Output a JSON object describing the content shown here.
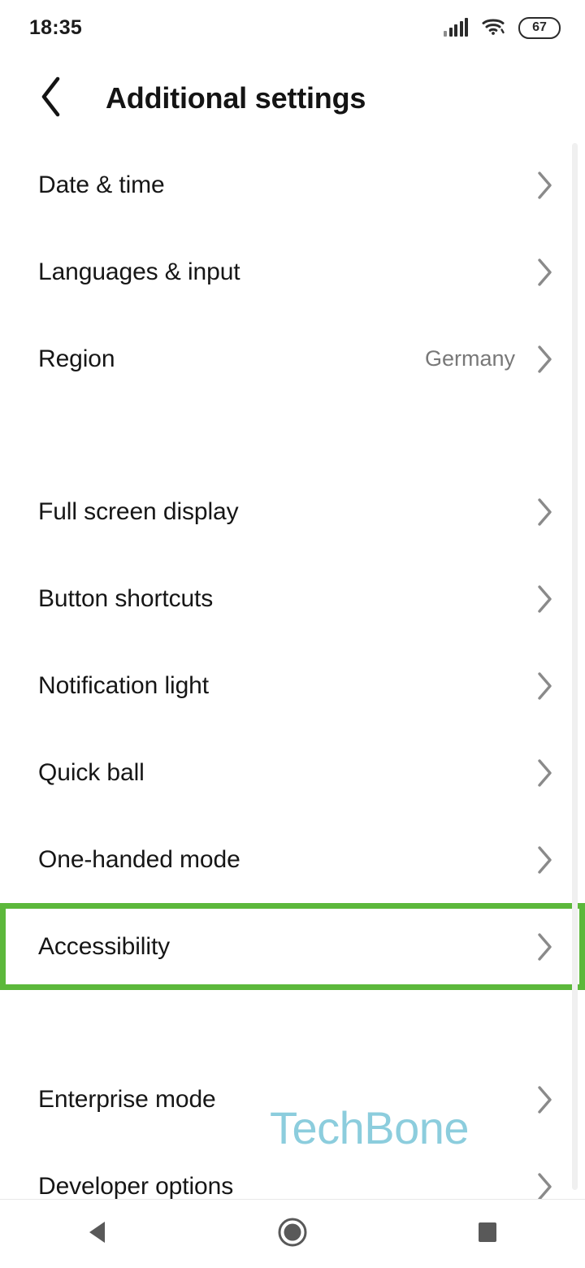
{
  "status_bar": {
    "time": "18:35",
    "signal_icon": "signal-bars-icon",
    "wifi_icon": "wifi-icon",
    "battery_icon": "battery-icon",
    "battery_level": "67"
  },
  "app_bar": {
    "back_icon": "back-chevron-icon",
    "title": "Additional settings"
  },
  "groups": [
    {
      "rows": [
        {
          "label": "Date & time",
          "value": "",
          "chevron": "chevron-right-icon",
          "highlighted": false
        },
        {
          "label": "Languages & input",
          "value": "",
          "chevron": "chevron-right-icon",
          "highlighted": false
        },
        {
          "label": "Region",
          "value": "Germany",
          "chevron": "chevron-right-icon",
          "highlighted": false
        }
      ]
    },
    {
      "rows": [
        {
          "label": "Full screen display",
          "value": "",
          "chevron": "chevron-right-icon",
          "highlighted": false
        },
        {
          "label": "Button shortcuts",
          "value": "",
          "chevron": "chevron-right-icon",
          "highlighted": false
        },
        {
          "label": "Notification light",
          "value": "",
          "chevron": "chevron-right-icon",
          "highlighted": false
        },
        {
          "label": "Quick ball",
          "value": "",
          "chevron": "chevron-right-icon",
          "highlighted": false
        },
        {
          "label": "One-handed mode",
          "value": "",
          "chevron": "chevron-right-icon",
          "highlighted": false
        },
        {
          "label": "Accessibility",
          "value": "",
          "chevron": "chevron-right-icon",
          "highlighted": true
        }
      ]
    },
    {
      "rows": [
        {
          "label": "Enterprise mode",
          "value": "",
          "chevron": "chevron-right-icon",
          "highlighted": false
        },
        {
          "label": "Developer options",
          "value": "",
          "chevron": "chevron-right-icon",
          "highlighted": false
        }
      ]
    }
  ],
  "watermark": {
    "text": "TechBone"
  },
  "nav_bar": {
    "back_label": "back-triangle-icon",
    "home_label": "home-circle-icon",
    "recents_label": "recents-square-icon"
  },
  "colors": {
    "highlight_green": "#5cb83b",
    "watermark_teal": "#8ccddd",
    "value_gray": "#787878",
    "chevron_gray": "#8a8a8a"
  }
}
